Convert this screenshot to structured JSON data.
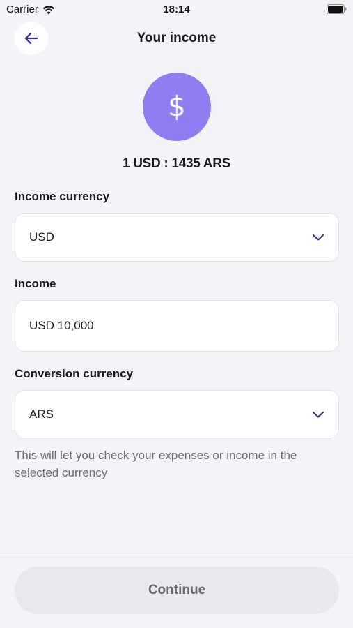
{
  "status_bar": {
    "carrier": "Carrier",
    "time": "18:14"
  },
  "header": {
    "title": "Your income"
  },
  "hero": {
    "symbol": "$",
    "rate": "1 USD : 1435 ARS"
  },
  "form": {
    "income_currency": {
      "label": "Income currency",
      "value": "USD"
    },
    "income": {
      "label": "Income",
      "value": "USD 10,000"
    },
    "conversion_currency": {
      "label": "Conversion currency",
      "value": "ARS"
    },
    "helper_text": "This will let you check your expenses or income in the selected currency"
  },
  "footer": {
    "continue_label": "Continue"
  },
  "colors": {
    "accent": "#8e7ef2",
    "icon_accent": "#3d2f8f",
    "background": "#f4f3f7"
  },
  "icons": {
    "back": "arrow-left-icon",
    "dropdown": "chevron-down-icon",
    "wifi": "wifi-icon",
    "battery": "battery-icon"
  }
}
